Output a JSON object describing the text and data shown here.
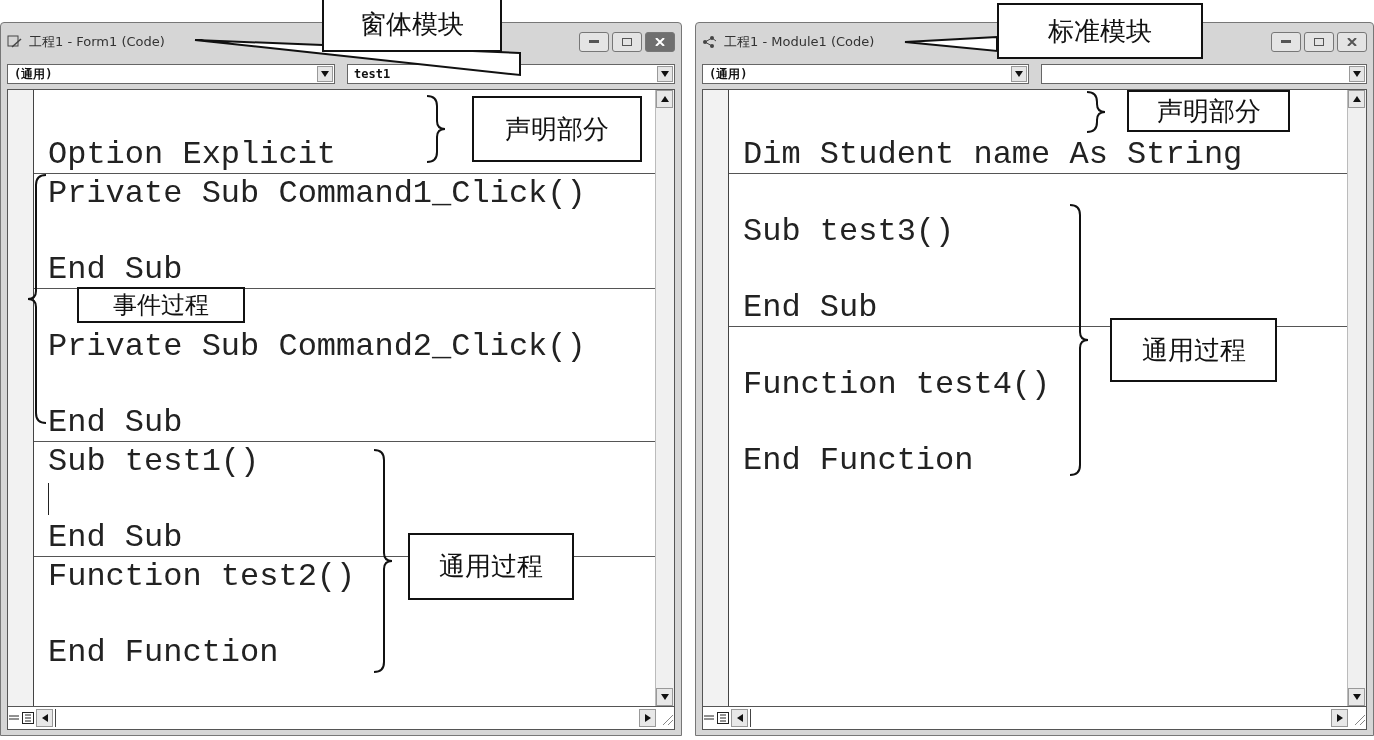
{
  "windows": [
    {
      "title": "工程1 - Form1 (Code)",
      "active": true,
      "object_combo": "(通用)",
      "procedure_combo": "test1",
      "sections": [
        {
          "lines": [
            {
              "kind": "blank"
            },
            {
              "kind": "code",
              "text": "Option Explicit"
            }
          ]
        },
        {
          "lines": [
            {
              "kind": "code",
              "text": "Private Sub Command1_Click()"
            },
            {
              "kind": "blank"
            },
            {
              "kind": "code",
              "text": "End Sub"
            }
          ]
        },
        {
          "lines": [
            {
              "kind": "blank"
            },
            {
              "kind": "code",
              "text": "Private Sub Command2_Click()"
            },
            {
              "kind": "blank"
            },
            {
              "kind": "code",
              "text": "End Sub"
            }
          ]
        },
        {
          "lines": [
            {
              "kind": "code",
              "text": "Sub test1()"
            },
            {
              "kind": "caret"
            },
            {
              "kind": "code",
              "text": "End Sub"
            }
          ]
        },
        {
          "lines": [
            {
              "kind": "code",
              "text": "Function test2()"
            },
            {
              "kind": "blank"
            },
            {
              "kind": "code",
              "text": "End Function"
            }
          ]
        }
      ]
    },
    {
      "title": "工程1 - Module1 (Code)",
      "active": false,
      "object_combo": "(通用)",
      "sections": [
        {
          "lines": [
            {
              "kind": "blank"
            },
            {
              "kind": "code",
              "text": "Dim Student name As String"
            }
          ]
        },
        {
          "lines": [
            {
              "kind": "blank"
            },
            {
              "kind": "code",
              "text": "Sub test3()"
            },
            {
              "kind": "blank"
            },
            {
              "kind": "code",
              "text": "End Sub"
            }
          ]
        },
        {
          "lines": [
            {
              "kind": "blank"
            },
            {
              "kind": "code",
              "text": "Function test4()"
            },
            {
              "kind": "blank"
            },
            {
              "kind": "code",
              "text": "End Function"
            }
          ]
        }
      ]
    }
  ],
  "callouts": [
    {
      "text": "窗体模块",
      "kind": "pointer"
    },
    {
      "text": "声明部分",
      "kind": "brace"
    },
    {
      "text": "事件过程",
      "kind": "brace"
    },
    {
      "text": "通用过程",
      "kind": "brace"
    },
    {
      "text": "标准模块",
      "kind": "pointer"
    },
    {
      "text": "声明部分",
      "kind": "brace"
    },
    {
      "text": "通用过程",
      "kind": "brace"
    }
  ]
}
